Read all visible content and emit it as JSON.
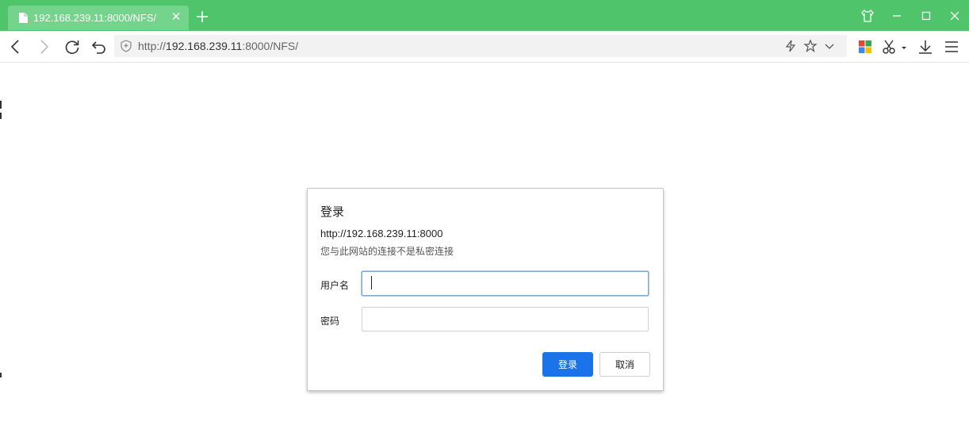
{
  "browser": {
    "tab": {
      "title": "192.168.239.11:8000/NFS/",
      "icon": "page-icon"
    },
    "new_tab_icon": "plus-icon",
    "window_controls": [
      "skin-icon",
      "minimize-icon",
      "maximize-icon",
      "close-icon"
    ],
    "nav": [
      "back-icon",
      "forward-icon",
      "reload-icon",
      "undo-icon"
    ],
    "address": {
      "scheme": "http://",
      "host": "192.168.239.11",
      "rest": ":8000/NFS/"
    },
    "toolbar": [
      "apps-icon",
      "scissors-icon",
      "download-icon",
      "menu-icon"
    ],
    "accent": "#4fc46a"
  },
  "dialog": {
    "title": "登录",
    "origin": "http://192.168.239.11:8000",
    "warning": "您与此网站的连接不是私密连接",
    "username_label": "用户名",
    "username_value": "",
    "password_label": "密码",
    "password_value": "",
    "login_button": "登录",
    "cancel_button": "取消",
    "primary_color": "#1a73e8"
  }
}
